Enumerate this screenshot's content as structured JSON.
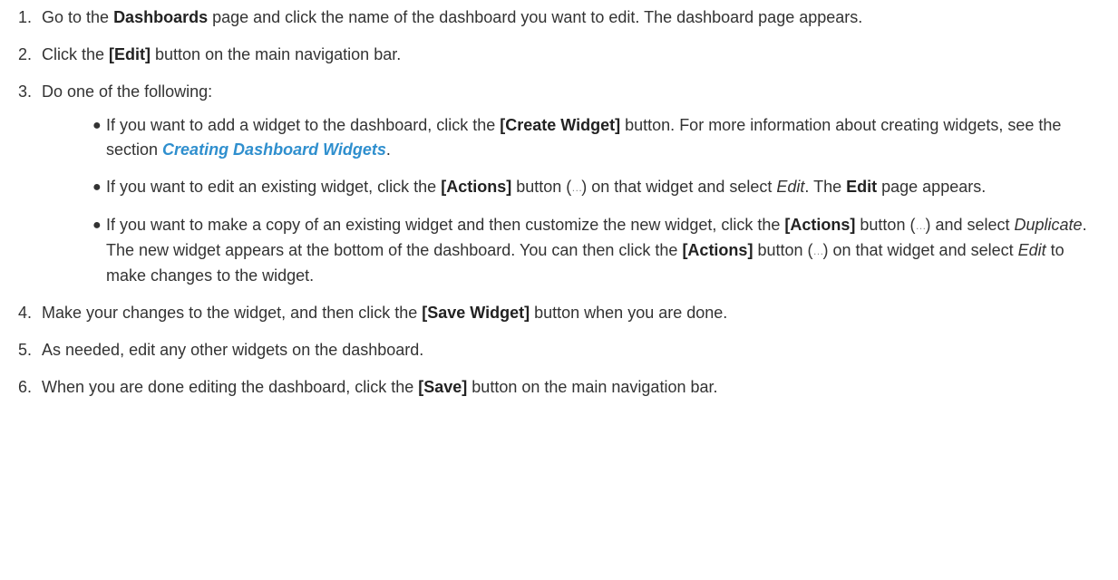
{
  "steps": [
    {
      "num": "1.",
      "t1": "Go to the ",
      "b1": "Dashboards",
      "t2": " page and click the name of the dashboard you want to edit. The dashboard page appears."
    },
    {
      "num": "2.",
      "t1": "Click the ",
      "b1": "[Edit]",
      "t2": " button on the main navigation bar."
    },
    {
      "num": "3.",
      "t1": "Do one of the following:",
      "bullets": [
        {
          "t1": "If you want to add a widget to the dashboard, click the ",
          "b1": "[Create Widget]",
          "t2": " button. For more information about creating widgets, see the section ",
          "link": "Creating Dashboard Widgets",
          "t3": "."
        },
        {
          "t1": "If you want to edit an existing widget, click the ",
          "b1": "[Actions]",
          "t2": " button (",
          "icon": "…",
          "t3": ") on that widget and select ",
          "i1": "Edit",
          "t4": ". The ",
          "b2": "Edit",
          "t5": " page appears."
        },
        {
          "t1": "If you want to make a copy of an existing widget and then customize the new widget, click the ",
          "b1": "[Actions]",
          "t2": " button (",
          "icon": "…",
          "t3": ") and select ",
          "i1": "Duplicate",
          "t4": ". The new widget appears at the bottom of the dashboard. You can then click the ",
          "b2": "[Actions]",
          "t5": " button (",
          "icon2": "…",
          "t6": ") on that widget and select ",
          "i2": "Edit",
          "t7": " to make changes to the widget."
        }
      ]
    },
    {
      "num": "4.",
      "t1": "Make your changes to the widget, and then click the ",
      "b1": "[Save Widget]",
      "t2": " button when you are done."
    },
    {
      "num": "5.",
      "t1": "As needed, edit any other widgets on the dashboard."
    },
    {
      "num": "6.",
      "t1": "When you are done editing the dashboard, click the ",
      "b1": "[Save]",
      "t2": " button on the main navigation bar."
    }
  ]
}
